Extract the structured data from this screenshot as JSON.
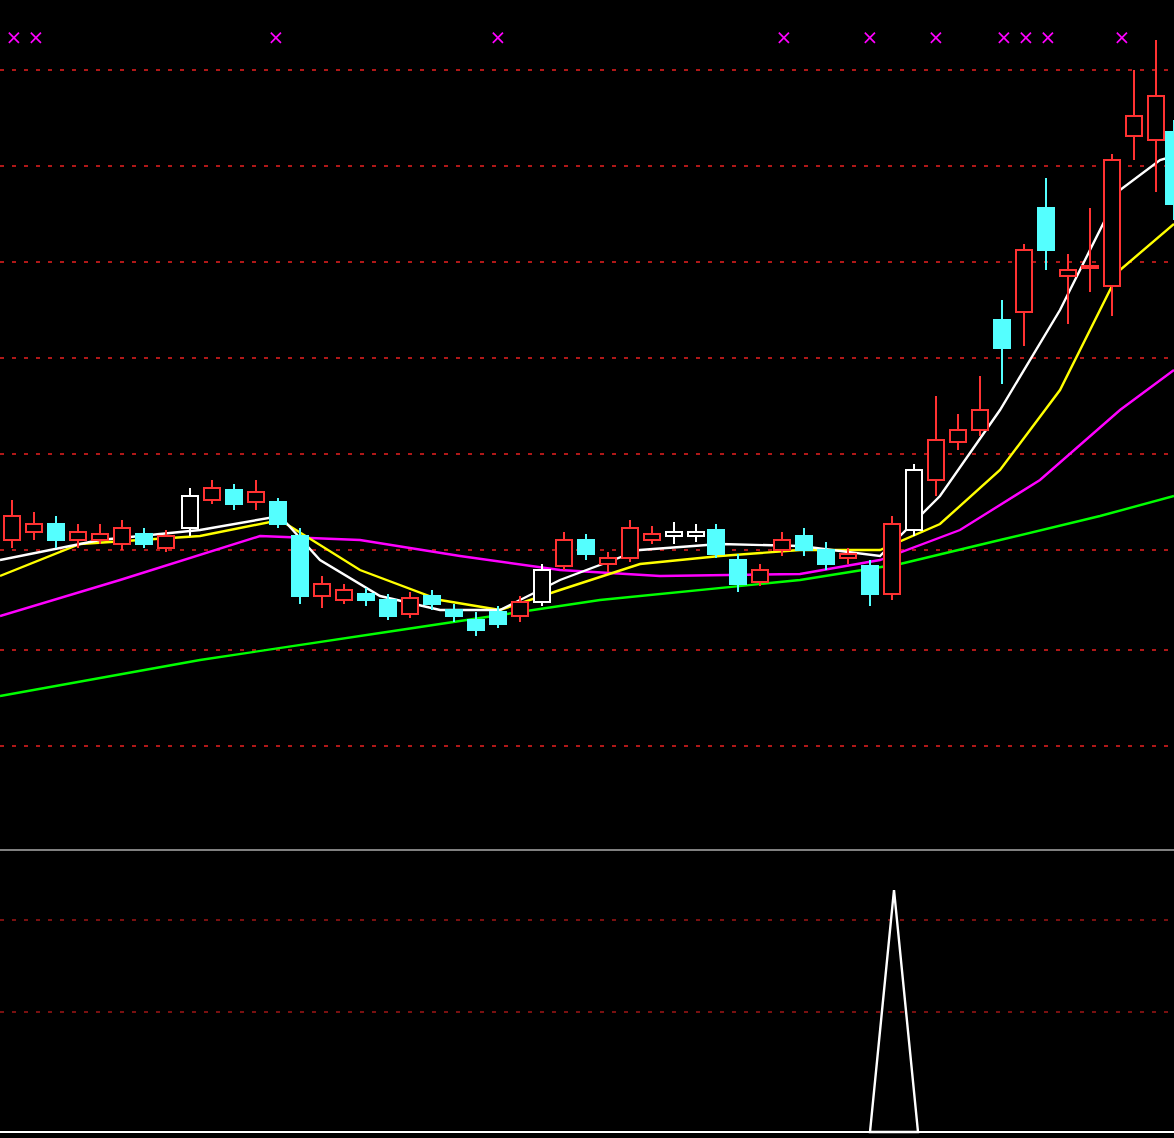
{
  "signal_marks": [
    {
      "text": "×"
    },
    {
      "text": "×"
    },
    {
      "text": "×"
    },
    {
      "text": "×"
    },
    {
      "text": "×"
    },
    {
      "text": "×"
    },
    {
      "text": "×"
    },
    {
      "text": "×"
    },
    {
      "text": "×"
    },
    {
      "text": "×"
    },
    {
      "text": "×"
    }
  ]
}
